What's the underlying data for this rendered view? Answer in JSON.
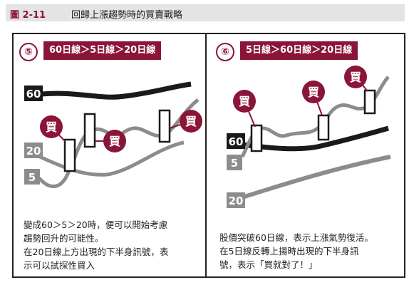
{
  "header": {
    "figure_label": "圖 2-11",
    "title": "回歸上漲趨勢時的買賣戰略"
  },
  "panels": [
    {
      "number": "⑤",
      "condition": "60日線＞5日線＞20日線",
      "line_labels": [
        "60",
        "20",
        "5"
      ],
      "signal_label": "買",
      "description": [
        "變成60＞5＞20時，便可以開始考慮",
        "趨勢回升的可能性。",
        "在20日線上方出現的下半身訊號，表",
        "示可以試探性買入"
      ]
    },
    {
      "number": "⑥",
      "condition": "5日線＞60日線＞20日線",
      "line_labels": [
        "60",
        "5",
        "20"
      ],
      "signal_label": "買",
      "description": [
        "股價突破60日線，表示上漲氣勢復活。",
        "在5日線反轉上揚時出現的下半身訊",
        "號，表示「買就對了！」"
      ]
    }
  ],
  "colors": {
    "accent": "#8b1538",
    "line_dark": "#1a1a1a",
    "line_gray": "#8c8c8c",
    "header_bg": "#e4e4e4"
  }
}
